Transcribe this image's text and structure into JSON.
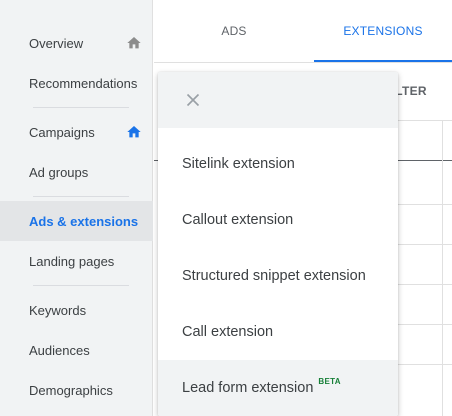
{
  "sidebar": {
    "items": [
      {
        "label": "Overview",
        "icon": "home-icon"
      },
      {
        "label": "Recommendations"
      },
      {
        "label": "Campaigns",
        "icon": "home-icon"
      },
      {
        "label": "Ad groups"
      },
      {
        "label": "Ads & extensions",
        "active": true
      },
      {
        "label": "Landing pages"
      },
      {
        "label": "Keywords"
      },
      {
        "label": "Audiences"
      },
      {
        "label": "Demographics"
      }
    ]
  },
  "tabs": [
    {
      "label": "ADS"
    },
    {
      "label": "EXTENSIONS",
      "active": true
    }
  ],
  "toolbar": {
    "filter_label": "FILTER"
  },
  "menu": {
    "close_icon": "close-icon",
    "items": [
      {
        "label": "Sitelink extension"
      },
      {
        "label": "Callout extension"
      },
      {
        "label": "Structured snippet extension"
      },
      {
        "label": "Call extension"
      },
      {
        "label": "Lead form extension",
        "badge": "BETA"
      }
    ]
  },
  "colors": {
    "accent": "#1a73e8",
    "sidebar_bg": "#f1f3f4",
    "beta_green": "#188038",
    "overview_icon_gray": "#8c8c8c"
  }
}
